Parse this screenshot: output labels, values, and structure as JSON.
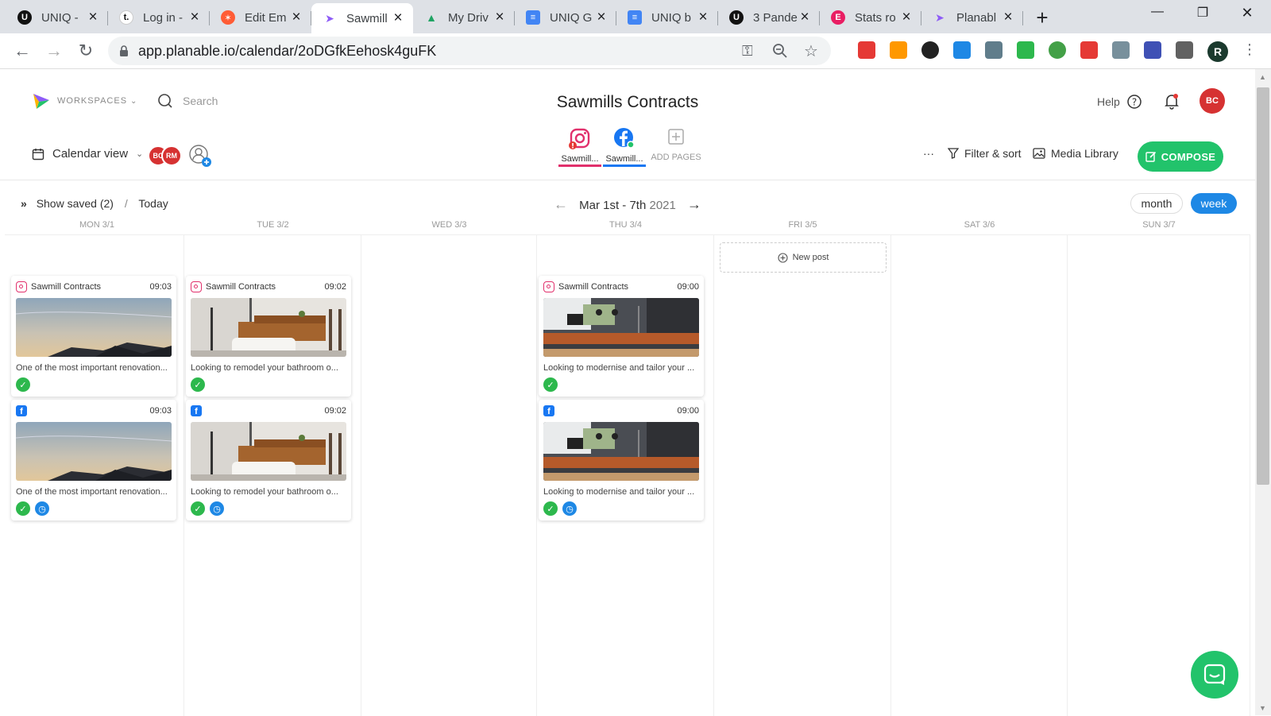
{
  "browser": {
    "tabs": [
      {
        "title": "UNIQ -",
        "fav_color": "#111111",
        "fav_letter": "U",
        "active": false
      },
      {
        "title": "Log in -",
        "fav_color": "#ffffff",
        "fav_letter": "t.",
        "active": false
      },
      {
        "title": "Edit Em",
        "fav_color": "#ff5c35",
        "fav_letter": "✶",
        "active": false
      },
      {
        "title": "Sawmill",
        "fav_color": "#8e5cf7",
        "fav_letter": "➤",
        "active": true
      },
      {
        "title": "My Driv",
        "fav_color": "#1fa463",
        "fav_letter": "▲",
        "active": false
      },
      {
        "title": "UNIQ G",
        "fav_color": "#4285f4",
        "fav_letter": "≡",
        "active": false
      },
      {
        "title": "UNIQ b",
        "fav_color": "#4285f4",
        "fav_letter": "≡",
        "active": false
      },
      {
        "title": "3 Pande",
        "fav_color": "#111111",
        "fav_letter": "U",
        "active": false
      },
      {
        "title": "Stats ro",
        "fav_color": "#e91e63",
        "fav_letter": "E",
        "active": false
      },
      {
        "title": "Planabl",
        "fav_color": "#8e5cf7",
        "fav_letter": "➤",
        "active": false
      }
    ],
    "url": "app.planable.io/calendar/2oDGfkEehosk4guFK",
    "profile_letter": "R"
  },
  "app": {
    "workspaces_label": "WORKSPACES",
    "search_placeholder": "Search",
    "title": "Sawmills Contracts",
    "help_label": "Help",
    "user_initials": "BC",
    "member_initials": [
      "BC",
      "RM"
    ],
    "calendar_view_label": "Calendar view",
    "pages": [
      {
        "label": "Sawmill...",
        "network": "instagram"
      },
      {
        "label": "Sawmill...",
        "network": "facebook"
      }
    ],
    "add_pages_label": "ADD PAGES",
    "more_label": "···",
    "filter_label": "Filter & sort",
    "media_label": "Media Library",
    "compose_label": "COMPOSE"
  },
  "calendar": {
    "show_saved_label": "Show saved (2)",
    "separator": "/",
    "today_label": "Today",
    "range_main": "Mar 1st - 7th",
    "range_year": "2021",
    "month_label": "month",
    "week_label": "week",
    "days": [
      "MON 3/1",
      "TUE 3/2",
      "WED 3/3",
      "THU 3/4",
      "FRI 3/5",
      "SAT 3/6",
      "SUN 3/7"
    ],
    "new_post_label": "New post",
    "posts": [
      {
        "day": 0,
        "slot": 0,
        "network": "instagram",
        "page": "Sawmill Contracts",
        "time": "09:03",
        "caption": "One of the most important renovation...",
        "image": "sky",
        "statuses": [
          "approved"
        ]
      },
      {
        "day": 0,
        "slot": 1,
        "network": "facebook",
        "page": "",
        "time": "09:03",
        "caption": "One of the most important renovation...",
        "image": "sky",
        "statuses": [
          "approved",
          "scheduled"
        ]
      },
      {
        "day": 1,
        "slot": 0,
        "network": "instagram",
        "page": "Sawmill Contracts",
        "time": "09:02",
        "caption": "Looking to remodel your bathroom o...",
        "image": "bathroom",
        "statuses": [
          "approved"
        ]
      },
      {
        "day": 1,
        "slot": 1,
        "network": "facebook",
        "page": "",
        "time": "09:02",
        "caption": "Looking to remodel your bathroom o...",
        "image": "bathroom",
        "statuses": [
          "approved",
          "scheduled"
        ]
      },
      {
        "day": 3,
        "slot": 0,
        "network": "instagram",
        "page": "Sawmill Contracts",
        "time": "09:00",
        "caption": "Looking to modernise and tailor your ...",
        "image": "kitchen",
        "statuses": [
          "approved"
        ]
      },
      {
        "day": 3,
        "slot": 1,
        "network": "facebook",
        "page": "",
        "time": "09:00",
        "caption": "Looking to modernise and tailor your ...",
        "image": "kitchen",
        "statuses": [
          "approved",
          "scheduled"
        ]
      }
    ]
  },
  "colors": {
    "accent_green": "#22c36b",
    "week_blue": "#1e88e5",
    "instagram": "#e1306c",
    "facebook": "#1877f2",
    "avatar_red": "#d63232"
  }
}
